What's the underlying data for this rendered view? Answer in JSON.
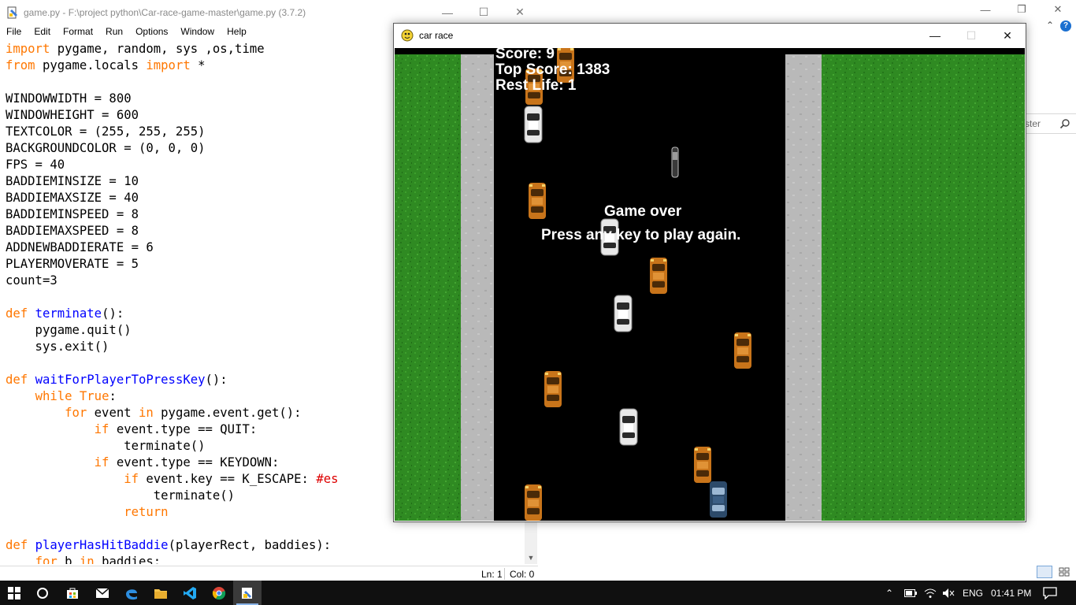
{
  "idle": {
    "title": "game.py - F:\\project python\\Car-race-game-master\\game.py (3.7.2)",
    "menu": [
      "File",
      "Edit",
      "Format",
      "Run",
      "Options",
      "Window",
      "Help"
    ],
    "status": {
      "line": "Ln: 1",
      "col": "Col: 0"
    },
    "code_lines": [
      [
        [
          "kw",
          "import"
        ],
        [
          "t",
          " pygame, random, sys ,os,time"
        ]
      ],
      [
        [
          "kw",
          "from"
        ],
        [
          "t",
          " pygame.locals "
        ],
        [
          "kw",
          "import"
        ],
        [
          "t",
          " *"
        ]
      ],
      [
        [
          "t",
          ""
        ]
      ],
      [
        [
          "t",
          "WINDOWWIDTH = 800"
        ]
      ],
      [
        [
          "t",
          "WINDOWHEIGHT = 600"
        ]
      ],
      [
        [
          "t",
          "TEXTCOLOR = (255, 255, 255)"
        ]
      ],
      [
        [
          "t",
          "BACKGROUNDCOLOR = (0, 0, 0)"
        ]
      ],
      [
        [
          "t",
          "FPS = 40"
        ]
      ],
      [
        [
          "t",
          "BADDIEMINSIZE = 10"
        ]
      ],
      [
        [
          "t",
          "BADDIEMAXSIZE = 40"
        ]
      ],
      [
        [
          "t",
          "BADDIEMINSPEED = 8"
        ]
      ],
      [
        [
          "t",
          "BADDIEMAXSPEED = 8"
        ]
      ],
      [
        [
          "t",
          "ADDNEWBADDIERATE = 6"
        ]
      ],
      [
        [
          "t",
          "PLAYERMOVERATE = 5"
        ]
      ],
      [
        [
          "t",
          "count=3"
        ]
      ],
      [
        [
          "t",
          ""
        ]
      ],
      [
        [
          "kw",
          "def"
        ],
        [
          "t",
          " "
        ],
        [
          "fn",
          "terminate"
        ],
        [
          "t",
          "():"
        ]
      ],
      [
        [
          "t",
          "    pygame.quit()"
        ]
      ],
      [
        [
          "t",
          "    sys.exit()"
        ]
      ],
      [
        [
          "t",
          ""
        ]
      ],
      [
        [
          "kw",
          "def"
        ],
        [
          "t",
          " "
        ],
        [
          "fn",
          "waitForPlayerToPressKey"
        ],
        [
          "t",
          "():"
        ]
      ],
      [
        [
          "t",
          "    "
        ],
        [
          "kw",
          "while"
        ],
        [
          "t",
          " "
        ],
        [
          "kw",
          "True"
        ],
        [
          "t",
          ":"
        ]
      ],
      [
        [
          "t",
          "        "
        ],
        [
          "kw",
          "for"
        ],
        [
          "t",
          " event "
        ],
        [
          "kw",
          "in"
        ],
        [
          "t",
          " pygame.event.get():"
        ]
      ],
      [
        [
          "t",
          "            "
        ],
        [
          "kw",
          "if"
        ],
        [
          "t",
          " event.type == QUIT:"
        ]
      ],
      [
        [
          "t",
          "                terminate()"
        ]
      ],
      [
        [
          "t",
          "            "
        ],
        [
          "kw",
          "if"
        ],
        [
          "t",
          " event.type == KEYDOWN:"
        ]
      ],
      [
        [
          "t",
          "                "
        ],
        [
          "kw",
          "if"
        ],
        [
          "t",
          " event.key == K_ESCAPE: "
        ],
        [
          "cm",
          "#es"
        ]
      ],
      [
        [
          "t",
          "                    terminate()"
        ]
      ],
      [
        [
          "t",
          "                "
        ],
        [
          "kw",
          "return"
        ]
      ],
      [
        [
          "t",
          ""
        ]
      ],
      [
        [
          "kw",
          "def"
        ],
        [
          "t",
          " "
        ],
        [
          "fn",
          "playerHasHitBaddie"
        ],
        [
          "t",
          "(playerRect, baddies):"
        ]
      ],
      [
        [
          "t",
          "    "
        ],
        [
          "kw",
          "for"
        ],
        [
          "t",
          " b "
        ],
        [
          "kw",
          "in"
        ],
        [
          "t",
          " baddies:"
        ]
      ]
    ]
  },
  "background_window": {
    "search_placeholder": "ster"
  },
  "race": {
    "title": "car race",
    "hud": {
      "score": "Score: 9",
      "top_score": "Top Score: 1383",
      "rest_life": "Rest Life: 1"
    },
    "messages": {
      "game_over": "Game over",
      "press_key": "Press any key to play again."
    }
  },
  "taskbar": {
    "language": "ENG",
    "time": "01:41 PM",
    "apps": [
      "windows-start-icon",
      "cortana-icon",
      "store-icon",
      "mail-icon",
      "edge-icon",
      "file-explorer-icon",
      "vscode-icon",
      "chrome-icon",
      "python-idle-icon"
    ]
  },
  "colors": {
    "grass": "#2f8a22",
    "sidewalk": "#b9b9b9",
    "road": "#000000",
    "orange_car": "#c8741a",
    "white_car": "#e8e8e8",
    "player_car": "#2c4a6a",
    "keyword": "#ff7700",
    "function_name": "#0000ff",
    "comment": "#dd0000"
  }
}
